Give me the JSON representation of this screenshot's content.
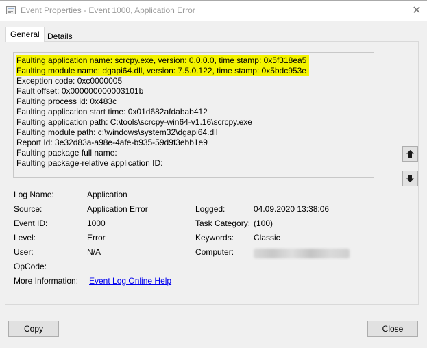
{
  "window": {
    "title": "Event Properties - Event 1000, Application Error",
    "close_symbol": "✕"
  },
  "tabs": [
    {
      "label": "General",
      "active": true
    },
    {
      "label": "Details",
      "active": false
    }
  ],
  "description": {
    "lines": [
      "Faulting application name: scrcpy.exe, version: 0.0.0.0, time stamp: 0x5f318ea5",
      "Faulting module name: dgapi64.dll, version: 7.5.0.122, time stamp: 0x5bdc953e",
      "Exception code: 0xc0000005",
      "Fault offset: 0x000000000003101b",
      "Faulting process id: 0x483c",
      "Faulting application start time: 0x01d682afdabab412",
      "Faulting application path: C:\\tools\\scrcpy-win64-v1.16\\scrcpy.exe",
      "Faulting module path: c:\\windows\\system32\\dgapi64.dll",
      "Report Id: 3e32d83a-a98e-4afe-b935-59d9f3ebb1e9",
      "Faulting package full name:",
      "Faulting package-relative application ID:"
    ],
    "highlight_color": "#f3f300"
  },
  "nav": {
    "up_icon": "arrow-up-icon",
    "down_icon": "arrow-down-icon"
  },
  "fields": {
    "log_name_label": "Log Name:",
    "log_name_value": "Application",
    "source_label": "Source:",
    "source_value": "Application Error",
    "logged_label": "Logged:",
    "logged_value": "04.09.2020 13:38:06",
    "event_id_label": "Event ID:",
    "event_id_value": "1000",
    "task_category_label": "Task Category:",
    "task_category_value": "(100)",
    "level_label": "Level:",
    "level_value": "Error",
    "keywords_label": "Keywords:",
    "keywords_value": "Classic",
    "user_label": "User:",
    "user_value": "N/A",
    "computer_label": "Computer:",
    "opcode_label": "OpCode:",
    "more_info_label": "More Information:",
    "more_info_link": "Event Log Online Help"
  },
  "buttons": {
    "copy": "Copy",
    "close": "Close"
  }
}
